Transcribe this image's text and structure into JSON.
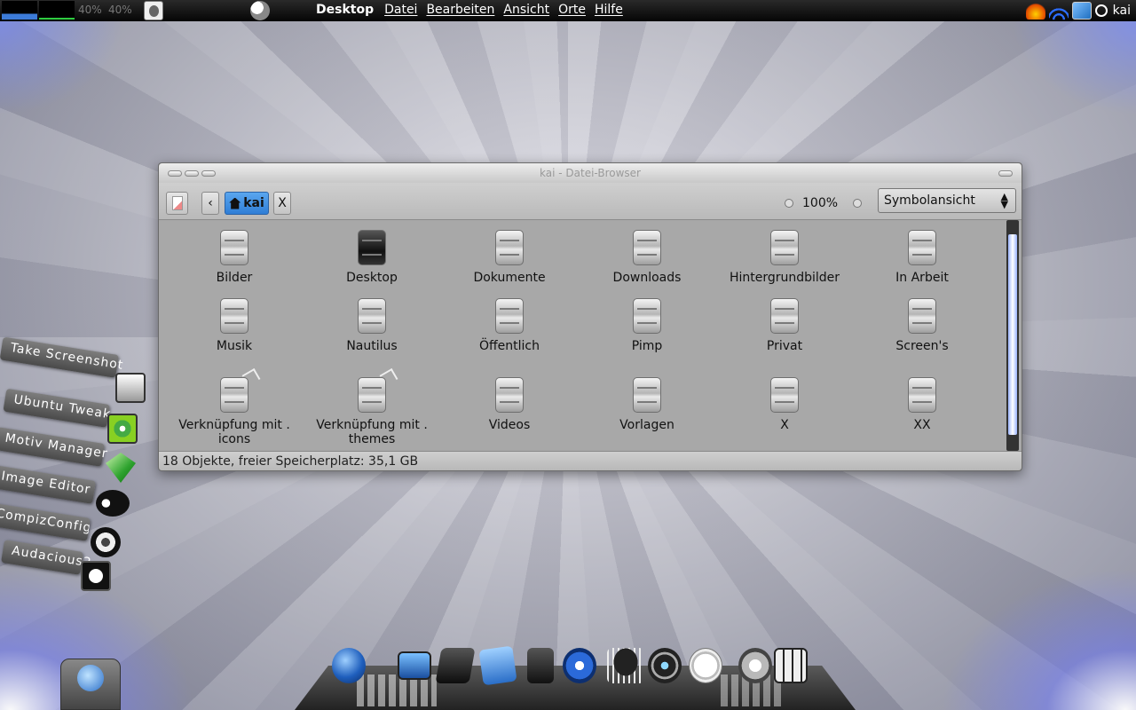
{
  "top_panel": {
    "cpu1": "40%",
    "cpu2": "40%",
    "menu": {
      "app": "Desktop",
      "items": [
        "Datei",
        "Bearbeiten",
        "Ansicht",
        "Orte",
        "Hilfe"
      ]
    },
    "user": "kai",
    "tray_icons": [
      "flame-icon",
      "wifi-icon",
      "screenshot-icon",
      "power-icon"
    ]
  },
  "window": {
    "title": "kai - Datei-Browser",
    "breadcrumb": [
      "kai",
      "X"
    ],
    "zoom": "100%",
    "view_mode": "Symbolansicht",
    "status": "18 Objekte, freier Speicherplatz: 35,1 GB",
    "items": [
      {
        "label": "Bilder"
      },
      {
        "label": "Desktop",
        "dark": true
      },
      {
        "label": "Dokumente"
      },
      {
        "label": "Downloads"
      },
      {
        "label": "Hintergrundbilder"
      },
      {
        "label": "In Arbeit"
      },
      {
        "label": "Musik"
      },
      {
        "label": "Nautilus"
      },
      {
        "label": "Öffentlich"
      },
      {
        "label": "Pimp"
      },
      {
        "label": "Privat"
      },
      {
        "label": "Screen's"
      },
      {
        "label": "Verknüpfung mit . icons",
        "link": true
      },
      {
        "label": "Verknüpfung mit . themes",
        "link": true
      },
      {
        "label": "Videos"
      },
      {
        "label": "Vorlagen"
      },
      {
        "label": "X"
      },
      {
        "label": "XX"
      }
    ]
  },
  "launcher": [
    {
      "label": "Take Screenshot",
      "icon": "camera-icon"
    },
    {
      "label": "Ubuntu Tweak",
      "icon": "ubuntu-tweak-icon"
    },
    {
      "label": "Motiv Manager",
      "icon": "gem-icon"
    },
    {
      "label": "Image Editor",
      "icon": "gimp-icon"
    },
    {
      "label": "CompizConfig Ei…",
      "icon": "compiz-icon"
    },
    {
      "label": "Audacious2",
      "icon": "audacious-icon"
    }
  ],
  "dock_icons": [
    "globe-icon",
    "monitor-icon",
    "folder-icon",
    "tools-icon",
    "trash-icon",
    "quicktime-icon",
    "weather-icon",
    "eye-icon",
    "clock-icon",
    "music-icon",
    "tiles-icon"
  ]
}
